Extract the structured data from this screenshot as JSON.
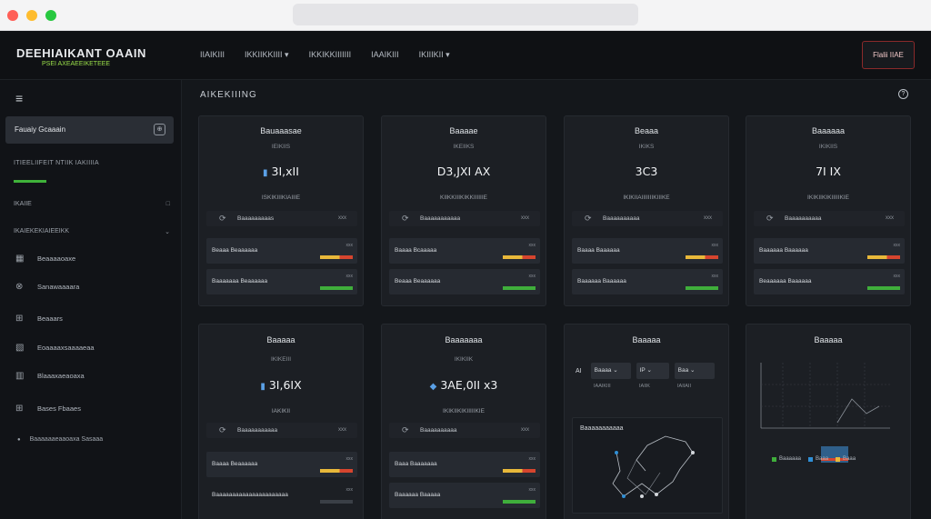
{
  "browser": {
    "url": ""
  },
  "brand": {
    "title": "DEEHIAIKANT OAAIN",
    "subtitle": "PSEI AXEAEEIKETEEE"
  },
  "nav": {
    "links": [
      "IIAIKIII",
      "IKKIIKKIIII ▾",
      "IKKIKKIIIIIII",
      "IAAIKIII",
      "IKIIIKII ▾"
    ],
    "button": "Flalii IIAE"
  },
  "sidebar": {
    "menu_icon": "≡",
    "active": {
      "label": "Fauaiy Gcaaain",
      "icon": "⊕"
    },
    "section_label": "ITIEELIIFEIT NTIIK IAKIIIIA",
    "row1": {
      "label": "IKAIIE",
      "right": "□"
    },
    "row2": {
      "label": "IKAIEKEKIAIEEIKK",
      "right": "⌄"
    },
    "items": [
      {
        "icon": "▦",
        "label": "Beaaaaoaxe"
      },
      {
        "icon": "⊗",
        "label": "Sanawaaaara"
      },
      {
        "icon": "⊞",
        "label": "Beaaars"
      },
      {
        "icon": "▧",
        "label": "Eoaaaaxsaaaaeaa"
      },
      {
        "icon": "▥",
        "label": "Blaaaxaeaoaxa"
      },
      {
        "icon": "⊞",
        "label": "Bases Fbaaes"
      }
    ],
    "bottom": {
      "icon": "●",
      "label": "Baaaaaaeaaoaxa Sasaaa"
    }
  },
  "main": {
    "title": "AIKEKIIING",
    "help_icon": "?"
  },
  "cards": [
    {
      "title": "Bauaaasae",
      "sub": "IEIKIIS",
      "mark": "▮",
      "value": "3I,xII",
      "caption": "ISKIKIIIKIAIIIE",
      "strip_label": "Baaaaaaaaas",
      "strip_val": "xxx",
      "metrics": [
        {
          "label": "Beaaa Beaaaaaa",
          "tiny": "xxx",
          "kind": "warn",
          "fill": 1.0
        },
        {
          "label": "Baaaaaaa Beaaaaaa",
          "tiny": "xxx",
          "kind": "ok",
          "fill": 1.0
        }
      ]
    },
    {
      "title": "Baaaae",
      "sub": "IKEIIKS",
      "mark": "",
      "value": "D3,JXI AX",
      "caption": "KIIKKIIIKIKKIIIIIIE",
      "strip_label": "Baaaaaaaaaaa",
      "strip_val": "xxx",
      "metrics": [
        {
          "label": "Baaaa Bcaaaaa",
          "tiny": "xxx",
          "kind": "warn",
          "fill": 1.0
        },
        {
          "label": "Beaaa Beaaaaaa",
          "tiny": "xxx",
          "kind": "ok",
          "fill": 1.0
        }
      ]
    },
    {
      "title": "Beaaa",
      "sub": "IKIKS",
      "mark": "",
      "value": "3C3",
      "caption": "IKIKIIAIIIIIIIKIIIKE",
      "strip_label": "Baaaaaaaaaa",
      "strip_val": "xxx",
      "metrics": [
        {
          "label": "Baaaa Baaaaaa",
          "tiny": "xxx",
          "kind": "warn",
          "fill": 1.0
        },
        {
          "label": "Baaaaaa Baaaaaa",
          "tiny": "xxx",
          "kind": "ok",
          "fill": 1.0
        }
      ]
    },
    {
      "title": "Baaaaaa",
      "sub": "IKIKIIS",
      "mark": "",
      "value": "7I IX",
      "caption": "IKIKIIKIKIIIIIKIE",
      "strip_label": "Baaaaaaaaaa",
      "strip_val": "xxx",
      "metrics": [
        {
          "label": "Baaaaaa Baaaaaa",
          "tiny": "xxx",
          "kind": "warn",
          "fill": 1.0
        },
        {
          "label": "Beaaaaaa Baaaaaa",
          "tiny": "xxx",
          "kind": "ok",
          "fill": 1.0
        }
      ]
    },
    {
      "title": "Baaaaa",
      "sub": "IKIKEIII",
      "mark": "▮",
      "value": "3I,6IX",
      "caption": "IAKIKII",
      "strip_label": "Baaaaaaaaaaa",
      "strip_val": "xxx",
      "metrics": [
        {
          "label": "Baaaa Beaaaaaa",
          "tiny": "xxx",
          "kind": "warn",
          "fill": 1.0
        },
        {
          "label": "Baaaaaaaaaaaaaaaaaaaaaa",
          "tiny": "xxx",
          "kind": "ok",
          "fill": 0.0
        }
      ]
    },
    {
      "title": "Baaaaaaa",
      "sub": "IKIKIIK",
      "mark": "◆",
      "value": "3AE,0II x3",
      "caption": "IKIKIIKIKIIIIIKIE",
      "strip_label": "Baaaaaaaaaa",
      "strip_val": "xxx",
      "metrics": [
        {
          "label": "Baaa Baaaaaaa",
          "tiny": "xxx",
          "kind": "warn",
          "fill": 1.0
        },
        {
          "label": "Baaaaaa Baaaaa",
          "tiny": "xxx",
          "kind": "ok",
          "fill": 1.0
        }
      ]
    }
  ],
  "card7": {
    "title": "Baaaaa",
    "row_label": "AI",
    "cells": [
      "Baaaa ⌄",
      "IP ⌄",
      "Baa ⌄"
    ],
    "cell_sub": [
      "IAAIKIII",
      "IAIIK",
      "IAIIAII"
    ],
    "panel_label": "Baaaaaaaaaaa"
  },
  "card8": {
    "title": "Baaaaa",
    "legend": [
      {
        "label": "Baaaaaa",
        "color": "#3fae3b"
      },
      {
        "label": "Baaa",
        "color": "#2f8fd6"
      },
      {
        "label": "Baaa",
        "color": "#e8b83a"
      }
    ]
  }
}
